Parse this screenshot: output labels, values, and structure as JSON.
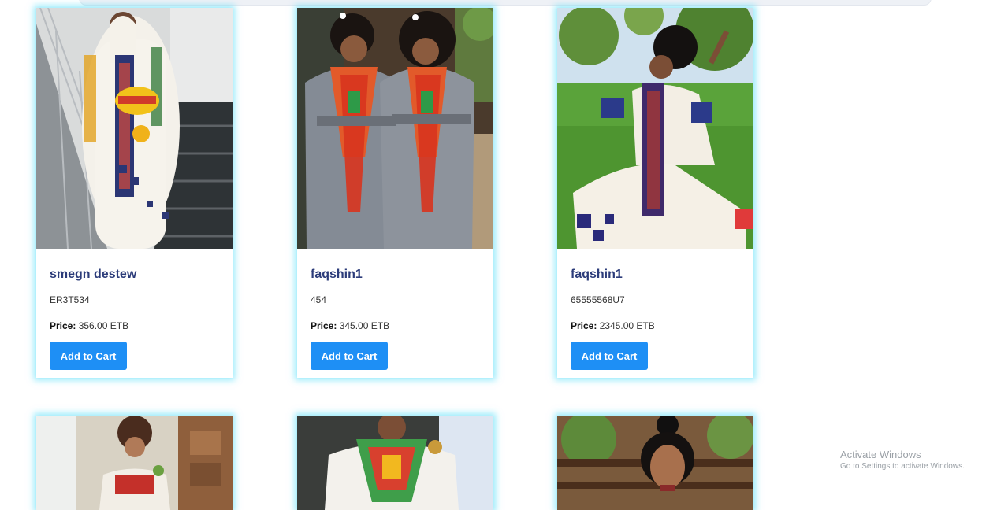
{
  "products": [
    {
      "name": "smegn destew",
      "code": "ER3T534",
      "price_label": "Price:",
      "price": "356.00 ETB",
      "button": "Add to Cart"
    },
    {
      "name": "faqshin1",
      "code": "454",
      "price_label": "Price:",
      "price": "345.00 ETB",
      "button": "Add to Cart"
    },
    {
      "name": "faqshin1",
      "code": "65555568U7",
      "price_label": "Price:",
      "price": "2345.00 ETB",
      "button": "Add to Cart"
    }
  ],
  "theme": {
    "accent": "#1e8ff5",
    "card_glow": "#40d8f8",
    "name_color": "#2c3c7a"
  },
  "watermark": {
    "title": "Activate Windows",
    "subtitle": "Go to Settings to activate Windows."
  }
}
